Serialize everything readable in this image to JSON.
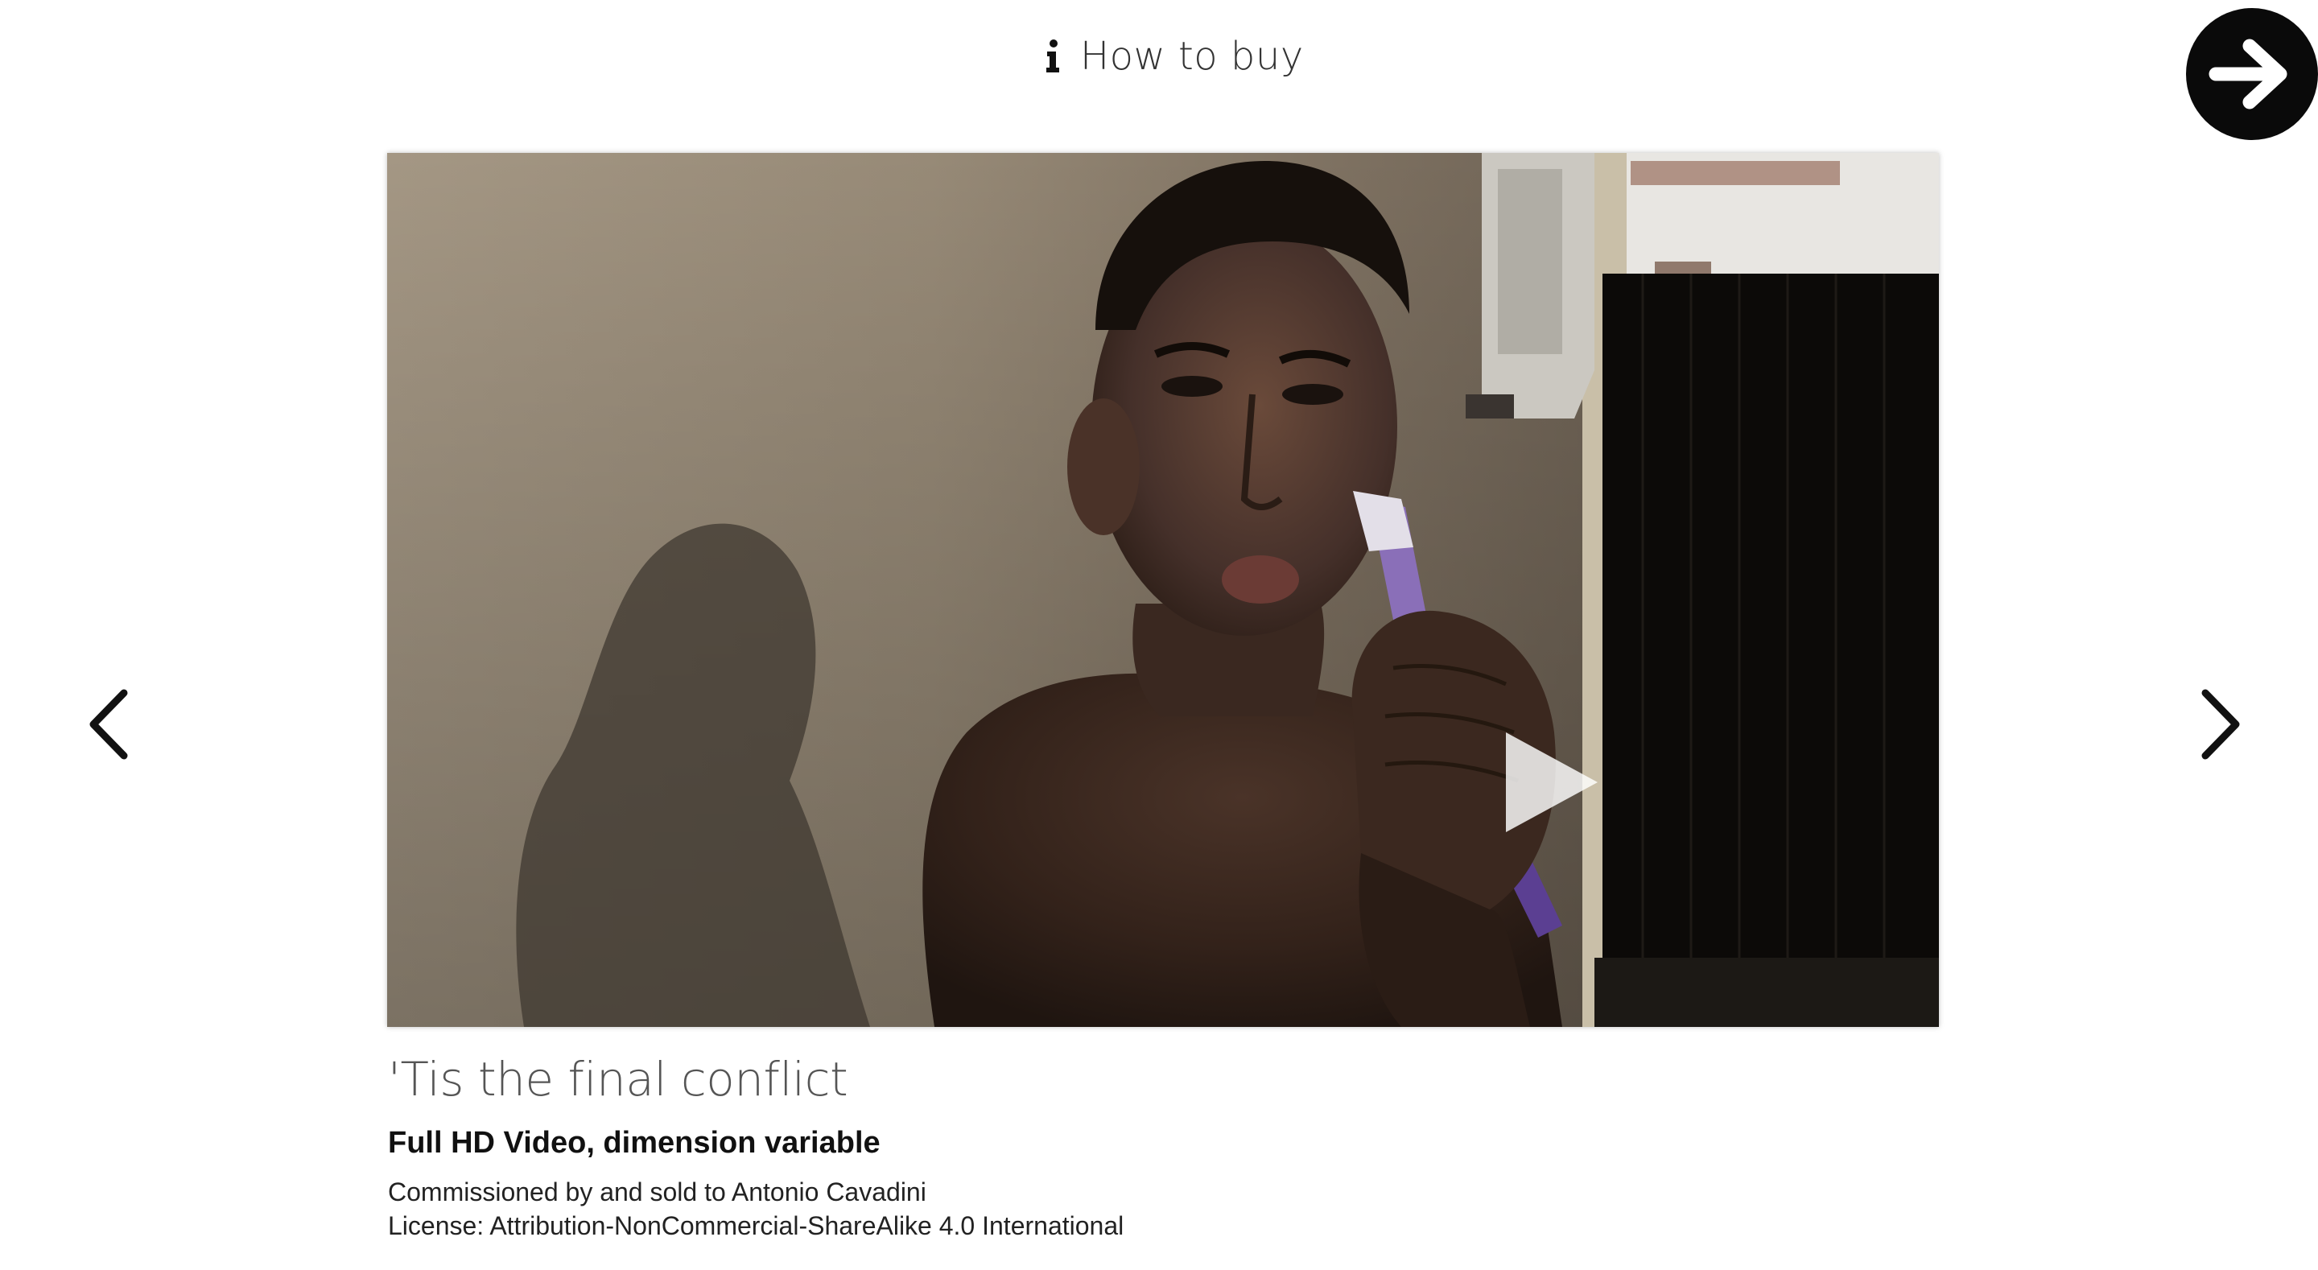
{
  "header": {
    "how_to_buy_label": "How to buy",
    "info_icon": "info-icon"
  },
  "navigation": {
    "next_circle_icon": "arrow-right-circle-icon",
    "prev_icon": "chevron-left-icon",
    "next_icon": "chevron-right-icon"
  },
  "video": {
    "play_icon": "play-icon"
  },
  "artwork": {
    "title": "'Tis the final conflict",
    "format": "Full HD Video, dimension variable",
    "commission": "Commissioned by and sold to Antonio Cavadini",
    "license": "License: Attribution-NonCommercial-ShareAlike 4.0 International"
  },
  "colors": {
    "background": "#ffffff",
    "circle_button": "#0a0a0a",
    "text_primary": "#111111",
    "text_title": "#555555"
  }
}
